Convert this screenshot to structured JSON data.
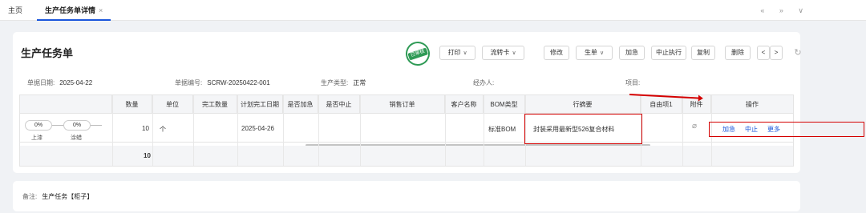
{
  "tabs": {
    "home": "主页",
    "active": "生产任务单详情",
    "close": "×"
  },
  "tab_tools": [
    "«",
    "»",
    "∨"
  ],
  "page_title": "生产任务单",
  "stamp_text": "已审核",
  "toolbar": {
    "print": "打印",
    "flow_card": "流转卡",
    "modify": "修改",
    "generate": "生单",
    "urgent": "加急",
    "stop_exec": "中止执行",
    "copy": "复制",
    "delete": "删除",
    "prev": "<",
    "next": ">",
    "refresh": "↻",
    "caret": "∨"
  },
  "info": {
    "date_label": "单据日期:",
    "date_value": "2025-04-22",
    "no_label": "单据编号:",
    "no_value": "SCRW-20250422-001",
    "type_label": "生产类型:",
    "type_value": "正常",
    "handler_label": "经办人:",
    "handler_value": "",
    "project_label": "项目:",
    "project_value": ""
  },
  "table": {
    "headers": [
      "数量",
      "单位",
      "完工数量",
      "计划完工日期",
      "是否加急",
      "是否中止",
      "销售订单",
      "客户名称",
      "BOM类型",
      "行摘要",
      "自由项1",
      "附件",
      "操作"
    ],
    "row": {
      "progress": [
        {
          "value": "0%",
          "label": "上漆"
        },
        {
          "value": "0%",
          "label": "涂蜡"
        }
      ],
      "qty": "10",
      "unit": "个",
      "plan_date": "2025-04-26",
      "bom_type": "标准BOM",
      "summary": "封装采用最新型526复合材料"
    },
    "ops": [
      "加急",
      "中止",
      "更多"
    ],
    "footer_total": "10"
  },
  "remark": {
    "label": "备注:",
    "value": "生产任务【柜子】"
  }
}
